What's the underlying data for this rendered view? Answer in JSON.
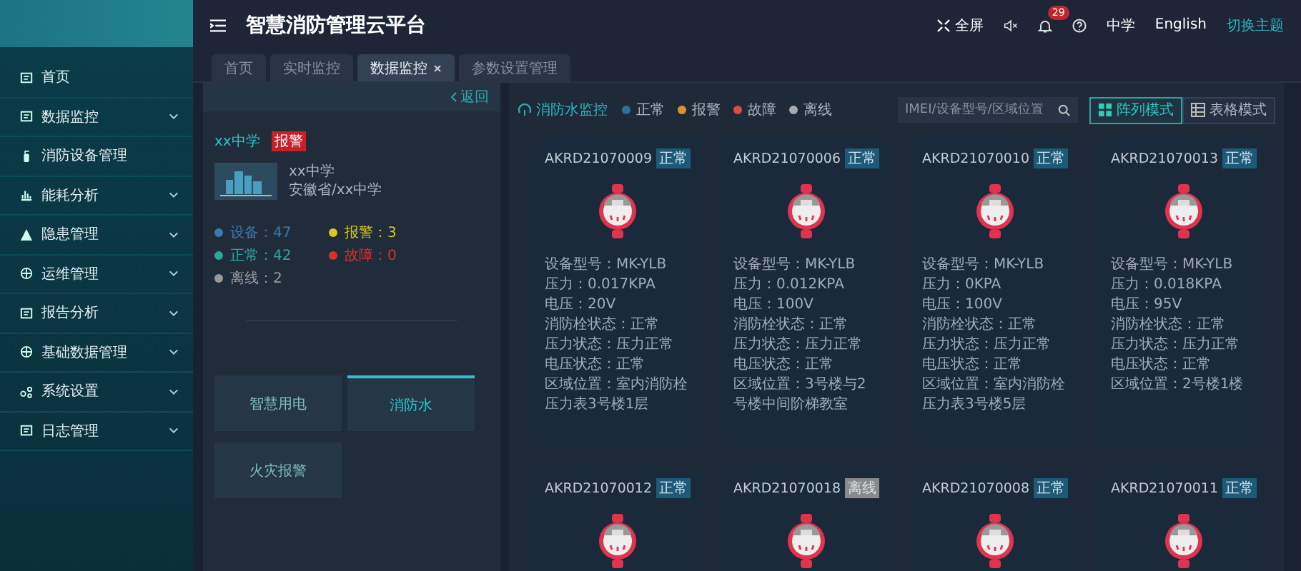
{
  "header": {
    "title": "智慧消防管理云平台",
    "fullscreen": "全屏",
    "notifications": "29",
    "school": "中学",
    "language": "English",
    "theme_link": "切换主题"
  },
  "sidebar": {
    "items": [
      {
        "label": "首页",
        "expandable": false
      },
      {
        "label": "数据监控",
        "expandable": true
      },
      {
        "label": "消防设备管理",
        "expandable": false
      },
      {
        "label": "能耗分析",
        "expandable": true
      },
      {
        "label": "隐患管理",
        "expandable": true
      },
      {
        "label": "运维管理",
        "expandable": true
      },
      {
        "label": "报告分析",
        "expandable": true
      },
      {
        "label": "基础数据管理",
        "expandable": true
      },
      {
        "label": "系统设置",
        "expandable": true
      },
      {
        "label": "日志管理",
        "expandable": true
      }
    ]
  },
  "tabs": [
    {
      "label": "首页",
      "selected": false,
      "closable": false
    },
    {
      "label": "实时监控",
      "selected": false,
      "closable": false
    },
    {
      "label": "数据监控",
      "selected": true,
      "closable": true
    },
    {
      "label": "参数设置管理",
      "selected": false,
      "closable": false
    }
  ],
  "site_panel": {
    "back": "返回",
    "name": "xx中学",
    "alarm_badge": "报警",
    "unit_name": "xx中学",
    "address": "安徽省/xx中学",
    "stats": [
      {
        "label": "设备：47",
        "color": "#3b78b0"
      },
      {
        "label": "报警：3",
        "color": "#d6c72a"
      },
      {
        "label": "正常：42",
        "color": "#2ba7a0"
      },
      {
        "label": "故障：0",
        "color": "#d8302f"
      },
      {
        "label": "离线：2",
        "color": "#9a9a9a"
      }
    ],
    "categories": [
      {
        "label": "智慧用电",
        "selected": false
      },
      {
        "label": "消防水",
        "selected": true
      },
      {
        "label": "火灾报警",
        "selected": false
      }
    ]
  },
  "monitor": {
    "title": "消防水监控",
    "legend": [
      {
        "label": "正常",
        "color": "#2f6f9a"
      },
      {
        "label": "报警",
        "color": "#e0922a"
      },
      {
        "label": "故障",
        "color": "#d9503f"
      },
      {
        "label": "离线",
        "color": "#aaaaaa"
      }
    ],
    "search": {
      "placeholder": "IMEI/设备型号/区域位置"
    },
    "view_modes": [
      {
        "label": "阵列模式",
        "selected": true
      },
      {
        "label": "表格模式",
        "selected": false
      }
    ],
    "devices": [
      {
        "id": "AKRD21070009",
        "status": "正常",
        "color": "#1d5a78",
        "fields": [
          "设备型号：MK-YLB",
          "压力：0.017KPA",
          "电压：20V",
          "消防栓状态：正常",
          "压力状态：压力正常",
          "电压状态：正常",
          "区域位置：室内消防栓压力表3号楼1层"
        ]
      },
      {
        "id": "AKRD21070006",
        "status": "正常",
        "color": "#1d5a78",
        "fields": [
          "设备型号：MK-YLB",
          "压力：0.012KPA",
          "电压：100V",
          "消防栓状态：正常",
          "压力状态：压力正常",
          "电压状态：正常",
          "区域位置：3号楼与2号楼中间阶梯教室"
        ]
      },
      {
        "id": "AKRD21070010",
        "status": "正常",
        "color": "#1d5a78",
        "fields": [
          "设备型号：MK-YLB",
          "压力：0KPA",
          "电压：100V",
          "消防栓状态：正常",
          "压力状态：压力正常",
          "电压状态：正常",
          "区域位置：室内消防栓压力表3号楼5层"
        ]
      },
      {
        "id": "AKRD21070013",
        "status": "正常",
        "color": "#1d5a78",
        "fields": [
          "设备型号：MK-YLB",
          "压力：0.018KPA",
          "电压：95V",
          "消防栓状态：正常",
          "压力状态：压力正常",
          "电压状态：正常",
          "区域位置：2号楼1楼"
        ]
      },
      {
        "id": "AKRD21070012",
        "status": "正常",
        "color": "#1d5a78"
      },
      {
        "id": "AKRD21070018",
        "status": "离线",
        "color": "#8a8a8a"
      },
      {
        "id": "AKRD21070008",
        "status": "正常",
        "color": "#1d5a78"
      },
      {
        "id": "AKRD21070011",
        "status": "正常",
        "color": "#1d5a78"
      }
    ]
  }
}
